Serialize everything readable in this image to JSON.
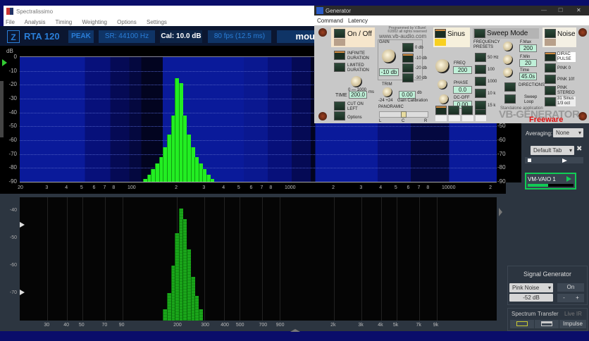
{
  "spectralissimo": {
    "title": "Spectralissimo",
    "menu": [
      "File",
      "Analysis",
      "Timing",
      "Weighting",
      "Options",
      "Settings"
    ],
    "toolbar": {
      "z": "Z",
      "mode": "RTA 120",
      "peak": "PEAK",
      "sr": "SR: 44100 Hz",
      "cal": "Cal:  10.0 dB",
      "fps": "80 fps (12.5 ms)",
      "mouse": "mou"
    }
  },
  "rta": {
    "unit": "dB",
    "y_labels": [
      "0",
      "-10",
      "-20",
      "-30",
      "-40",
      "-50",
      "-60",
      "-70",
      "-80",
      "-90"
    ],
    "meter_labels": [
      "-50",
      "-60",
      "-70",
      "-80",
      "-90"
    ],
    "x_labels": [
      {
        "f": 20,
        "t": "20"
      },
      {
        "f": 30,
        "t": "3"
      },
      {
        "f": 40,
        "t": "4"
      },
      {
        "f": 50,
        "t": "5"
      },
      {
        "f": 60,
        "t": "6"
      },
      {
        "f": 70,
        "t": "7"
      },
      {
        "f": 80,
        "t": "8"
      },
      {
        "f": 100,
        "t": "100"
      },
      {
        "f": 200,
        "t": "2"
      },
      {
        "f": 300,
        "t": "3"
      },
      {
        "f": 400,
        "t": "4"
      },
      {
        "f": 500,
        "t": "5"
      },
      {
        "f": 600,
        "t": "6"
      },
      {
        "f": 700,
        "t": "7"
      },
      {
        "f": 800,
        "t": "8"
      },
      {
        "f": 1000,
        "t": "1000"
      },
      {
        "f": 2000,
        "t": "2"
      },
      {
        "f": 3000,
        "t": "3"
      },
      {
        "f": 4000,
        "t": "4"
      },
      {
        "f": 5000,
        "t": "5"
      },
      {
        "f": 6000,
        "t": "6"
      },
      {
        "f": 7000,
        "t": "7"
      },
      {
        "f": 8000,
        "t": "8"
      },
      {
        "f": 10000,
        "t": "10000"
      },
      {
        "f": 20000,
        "t": "2"
      }
    ]
  },
  "chart_data": [
    {
      "type": "bar",
      "title": "RTA 120",
      "ylabel": "dB",
      "ylim": [
        -90,
        0
      ],
      "xscale": "log",
      "xlim": [
        20,
        22000
      ],
      "x": [
        126,
        133,
        141,
        150,
        159,
        168,
        178,
        189,
        200,
        212,
        224,
        238,
        252,
        267,
        283,
        300,
        317,
        336
      ],
      "values": [
        -88,
        -85,
        -81,
        -77,
        -72,
        -65,
        -56,
        -42,
        -15,
        -19,
        -42,
        -56,
        -65,
        -72,
        -77,
        -81,
        -85,
        -88
      ]
    },
    {
      "type": "bar",
      "ylim": [
        -80,
        -35
      ],
      "xscale": "log",
      "y_labels": [
        "-40",
        "-50",
        "-60",
        "-70"
      ],
      "x_labels": [
        "30",
        "40",
        "50",
        "70",
        "90",
        "200",
        "300",
        "400",
        "500",
        "700",
        "900",
        "2k",
        "3k",
        "4k",
        "5k",
        "7k",
        "9k"
      ],
      "x_label_freqs": [
        30,
        40,
        50,
        70,
        90,
        200,
        300,
        400,
        500,
        700,
        900,
        2000,
        3000,
        4000,
        5000,
        7000,
        9000
      ],
      "x": [
        168,
        178,
        189,
        200,
        212,
        224,
        238,
        252,
        267,
        283
      ],
      "values": [
        -76,
        -70,
        -60,
        -48,
        -39,
        -43,
        -54,
        -64,
        -71,
        -76
      ]
    }
  ],
  "right_panel": {
    "averaging_label": "Averaging:",
    "averaging": "None",
    "tab": "Default Tab",
    "device": "VM-VAIO 1",
    "signal_generator": {
      "title": "Signal Generator",
      "type": "Pink Noise",
      "on": "On",
      "level": "-52 dB",
      "minus": "-",
      "plus": "+"
    },
    "tabs": [
      "Spectrum",
      "Transfer",
      "Live IR"
    ],
    "impulse": "Impulse"
  },
  "generator": {
    "title": "Generator",
    "menu": [
      "Command",
      "Latency"
    ],
    "onoff": "On / Off",
    "infinite": "INFINITE DURATION",
    "limited": "LIMITED DURATION",
    "time_range": "0 — 1000",
    "ms": "ms",
    "time_label": "TIME",
    "time": "200.0",
    "cut": "CUT ON LEFT",
    "options": "Options",
    "credits": "Programmed by V.Burel ©2002 all rights reserved",
    "url": "www.vb-audio.com",
    "gain": "GAIN",
    "gain_value": "-10 db",
    "gain_buttons": [
      "0 db",
      "-10 db",
      "-20 db",
      "-30 db"
    ],
    "trim": "TRIM",
    "trim_value": "0.00",
    "db": "db",
    "trim_range": "-24   +24",
    "gain_cal": "Gain Calibration",
    "panoramic": "PANORAMIC",
    "pan_l": "L",
    "pan_c": "C",
    "pan_r": "R",
    "sinus": "Sinus",
    "freq": "FREQ",
    "freq_value": "200",
    "phase": "PHASE",
    "phase_value": "0.0",
    "dcoff": "DC-OFF",
    "dcoff_value": "0.00",
    "presets_label": "FREQUENCY PRESETS",
    "presets": [
      "50 Hz",
      "100",
      "1000",
      "10 k",
      "15 k"
    ],
    "sweep": "Sweep Mode",
    "fmax": "F.Max",
    "fmax_value": "200",
    "fmin": "F.Min",
    "fmin_value": "20",
    "time2": "Time",
    "time2_value": "45.0s",
    "directions": "DIRECTIONS",
    "sweep_loop": "Sweep Loop",
    "noise": "Noise",
    "noise_types": [
      "DIRAC PULSE",
      "PINK 0",
      "PINK 10f",
      "PINK STEREO",
      "31 Sinus 1/3 oct"
    ],
    "standalone": "Standalone application",
    "brand": "VB-GENERATOR",
    "freeware": "Freeware"
  }
}
